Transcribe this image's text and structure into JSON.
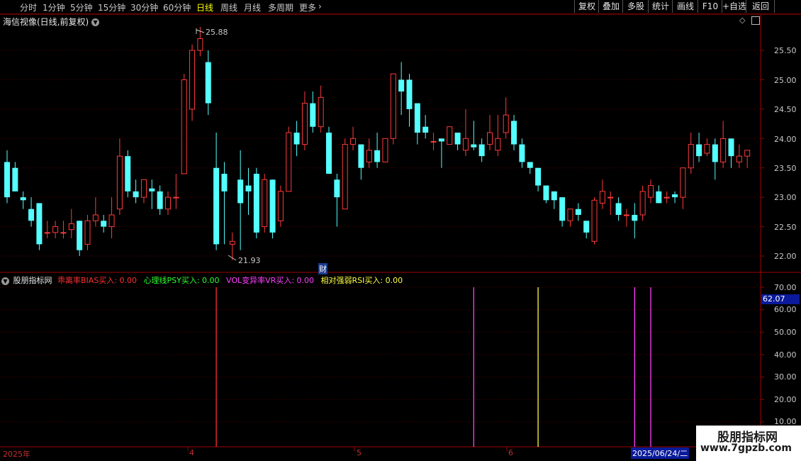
{
  "toolbar": {
    "periods": [
      "分时",
      "1分钟",
      "5分钟",
      "15分钟",
      "30分钟",
      "60分钟",
      "日线",
      "周线",
      "月线",
      "多周期",
      "更多"
    ],
    "active_period": "日线",
    "buttons": [
      "复权",
      "叠加",
      "多股",
      "统计",
      "画线",
      "F10",
      "+自选",
      "返回"
    ]
  },
  "main_chart": {
    "title": "海信视像(日线,前复权)",
    "high_label": "25.88",
    "low_label": "21.93",
    "finance_badge": "财",
    "price_ticks": [
      "25.50",
      "25.00",
      "24.50",
      "24.00",
      "23.50",
      "23.00",
      "22.50",
      "22.00"
    ]
  },
  "indicator": {
    "site": "股朋指标网",
    "items": [
      {
        "text": "乖离率BIAS买入: 0.00",
        "color": "#ff3030"
      },
      {
        "text": "心理线PSY买入: 0.00",
        "color": "#30ff30"
      },
      {
        "text": "VOL变异率VR买入: 0.00",
        "color": "#ff40ff"
      },
      {
        "text": "相对强弱RSI买入: 0.00",
        "color": "#ffff40"
      }
    ],
    "ticks": [
      "70.00",
      "60.00",
      "50.00",
      "40.00",
      "30.00",
      "20.00",
      "10.00"
    ],
    "cursor_value": "62.07"
  },
  "time_axis": {
    "labels": [
      "2025年",
      "4",
      "5",
      "6"
    ],
    "cursor_date": "2025/06/24/二"
  },
  "watermark": {
    "title": "股朋指标网",
    "url": "www.7gpzb.com"
  },
  "chart_data": {
    "type": "candlestick",
    "y_range": [
      21.8,
      25.95
    ],
    "candles": [
      [
        23.6,
        23.8,
        23.0,
        22.9
      ],
      [
        23.5,
        23.6,
        23.1,
        23.1
      ],
      [
        23.0,
        23.1,
        22.95,
        22.8
      ],
      [
        22.8,
        23.0,
        22.6,
        22.5
      ],
      [
        22.9,
        22.9,
        22.2,
        22.1
      ],
      [
        22.4,
        22.6,
        22.4,
        22.3
      ],
      [
        22.4,
        22.6,
        22.5,
        22.3
      ],
      [
        22.4,
        22.6,
        22.4,
        22.3
      ],
      [
        22.45,
        22.8,
        22.55,
        22.3
      ],
      [
        22.6,
        22.6,
        22.1,
        22.0
      ],
      [
        22.2,
        22.7,
        22.6,
        22.1
      ],
      [
        22.6,
        23.0,
        22.7,
        22.5
      ],
      [
        22.6,
        22.7,
        22.5,
        22.4
      ],
      [
        22.5,
        23.0,
        22.7,
        22.3
      ],
      [
        22.8,
        24.0,
        23.7,
        22.7
      ],
      [
        23.7,
        23.8,
        23.1,
        23.0
      ],
      [
        23.1,
        23.3,
        23.0,
        22.9
      ],
      [
        23.0,
        23.3,
        23.3,
        22.9
      ],
      [
        23.15,
        23.3,
        23.1,
        22.8
      ],
      [
        23.1,
        23.2,
        22.8,
        22.7
      ],
      [
        22.8,
        23.1,
        23.0,
        22.7
      ],
      [
        23.0,
        23.4,
        23.0,
        22.8
      ],
      [
        23.4,
        25.1,
        25.0,
        23.4
      ],
      [
        24.5,
        25.6,
        25.5,
        24.3
      ],
      [
        25.5,
        25.9,
        25.7,
        25.4
      ],
      [
        25.3,
        25.5,
        24.6,
        24.4
      ],
      [
        23.5,
        24.1,
        22.2,
        22.1
      ],
      [
        23.4,
        23.6,
        23.1,
        22.2
      ],
      [
        22.2,
        22.4,
        22.25,
        21.93
      ],
      [
        23.3,
        23.8,
        22.9,
        22.1
      ],
      [
        23.2,
        23.5,
        23.1,
        22.7
      ],
      [
        23.4,
        23.5,
        22.4,
        22.3
      ],
      [
        22.5,
        23.4,
        23.3,
        22.4
      ],
      [
        23.3,
        23.3,
        22.4,
        22.3
      ],
      [
        22.6,
        23.2,
        23.1,
        22.5
      ],
      [
        23.1,
        24.2,
        24.1,
        23.1
      ],
      [
        24.1,
        24.3,
        23.9,
        23.7
      ],
      [
        23.9,
        24.8,
        24.6,
        23.8
      ],
      [
        24.6,
        24.8,
        24.2,
        24.1
      ],
      [
        24.2,
        24.9,
        24.7,
        24.1
      ],
      [
        24.1,
        24.2,
        23.4,
        23.4
      ],
      [
        23.3,
        23.4,
        23.0,
        22.5
      ],
      [
        22.8,
        24.0,
        23.9,
        22.8
      ],
      [
        23.9,
        24.2,
        24.0,
        23.8
      ],
      [
        23.9,
        23.9,
        23.5,
        23.3
      ],
      [
        23.6,
        24.0,
        23.8,
        23.5
      ],
      [
        23.8,
        24.1,
        23.6,
        23.5
      ],
      [
        23.6,
        24.0,
        24.0,
        23.6
      ],
      [
        24.0,
        25.0,
        25.1,
        23.9
      ],
      [
        25.0,
        25.3,
        24.8,
        24.4
      ],
      [
        25.0,
        25.1,
        24.5,
        24.2
      ],
      [
        24.6,
        24.6,
        24.1,
        23.9
      ],
      [
        24.2,
        24.4,
        24.1,
        24.0
      ],
      [
        23.95,
        24.1,
        23.95,
        23.8
      ],
      [
        24.0,
        24.0,
        23.95,
        23.5
      ],
      [
        23.9,
        24.1,
        24.2,
        23.9
      ],
      [
        24.1,
        24.1,
        23.9,
        23.8
      ],
      [
        23.8,
        24.5,
        24.0,
        23.7
      ],
      [
        23.9,
        24.3,
        23.85,
        23.8
      ],
      [
        23.9,
        24.0,
        23.7,
        23.6
      ],
      [
        23.9,
        24.4,
        24.1,
        23.8
      ],
      [
        23.8,
        24.4,
        24.0,
        23.7
      ],
      [
        24.1,
        24.7,
        24.4,
        24.0
      ],
      [
        24.3,
        24.4,
        23.9,
        23.8
      ],
      [
        23.9,
        24.0,
        23.6,
        23.5
      ],
      [
        23.6,
        23.6,
        23.5,
        23.4
      ],
      [
        23.5,
        23.5,
        23.2,
        23.1
      ],
      [
        23.2,
        23.2,
        22.95,
        22.9
      ],
      [
        23.1,
        23.1,
        22.95,
        22.8
      ],
      [
        23.0,
        23.0,
        22.6,
        22.5
      ],
      [
        22.6,
        22.8,
        22.8,
        22.5
      ],
      [
        22.8,
        22.9,
        22.7,
        22.6
      ],
      [
        22.6,
        22.6,
        22.4,
        22.3
      ],
      [
        22.25,
        23.0,
        22.95,
        22.2
      ],
      [
        22.9,
        23.3,
        23.1,
        22.8
      ],
      [
        23.0,
        23.1,
        23.0,
        22.7
      ],
      [
        22.9,
        23.0,
        22.7,
        22.6
      ],
      [
        22.7,
        22.8,
        22.7,
        22.5
      ],
      [
        22.7,
        22.9,
        22.6,
        22.3
      ],
      [
        22.7,
        23.2,
        23.1,
        22.6
      ],
      [
        23.0,
        23.3,
        23.2,
        22.9
      ],
      [
        23.1,
        23.2,
        22.9,
        22.9
      ],
      [
        23.0,
        23.1,
        23.0,
        22.9
      ],
      [
        23.05,
        23.1,
        23.0,
        22.9
      ],
      [
        23.0,
        23.5,
        23.5,
        22.8
      ],
      [
        23.5,
        24.1,
        23.9,
        23.4
      ],
      [
        23.9,
        24.1,
        23.7,
        23.6
      ],
      [
        23.75,
        24.0,
        23.9,
        23.7
      ],
      [
        23.9,
        24.0,
        23.6,
        23.3
      ],
      [
        23.6,
        24.3,
        24.0,
        23.5
      ],
      [
        24.0,
        24.0,
        23.7,
        23.5
      ],
      [
        23.6,
        23.9,
        23.7,
        23.5
      ],
      [
        23.7,
        23.8,
        23.8,
        23.5
      ]
    ],
    "indicator_signals": [
      {
        "name": "乖离率BIAS买入",
        "color": "#ff3030",
        "indices": [
          26
        ]
      },
      {
        "name": "VOL变异率VR买入",
        "color": "#ff40ff",
        "indices": [
          58,
          78,
          80
        ]
      },
      {
        "name": "相对强弱RSI买入",
        "color": "#ffff40",
        "indices": [
          66
        ]
      }
    ]
  }
}
